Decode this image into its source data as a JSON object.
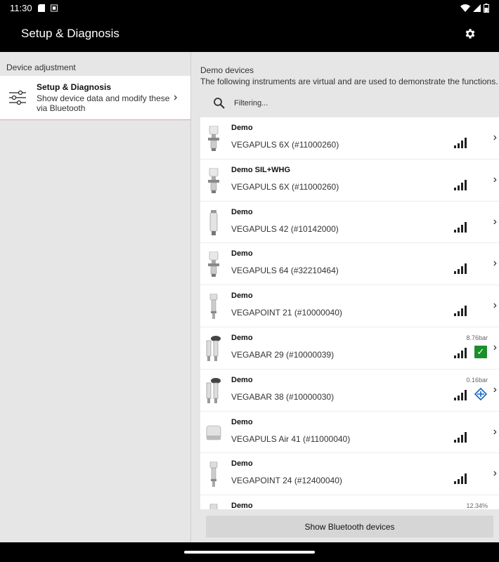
{
  "status_bar": {
    "time": "11:30"
  },
  "app_bar": {
    "title": "Setup & Diagnosis"
  },
  "left": {
    "section_label": "Device adjustment",
    "item": {
      "title": "Setup & Diagnosis",
      "description": "Show device data and modify these via Bluetooth"
    }
  },
  "right": {
    "header": "Demo devices",
    "subheader": "The following instruments are virtual and are used to demonstrate the functions.",
    "filter_placeholder": "Filtering...",
    "devices": [
      {
        "name": "Demo",
        "model": "VEGAPULS 6X (#11000260)",
        "value": "",
        "status": "",
        "image": "radar-sensor"
      },
      {
        "name": "Demo SIL+WHG",
        "model": "VEGAPULS 6X (#11000260)",
        "value": "",
        "status": "",
        "image": "radar-sensor"
      },
      {
        "name": "Demo",
        "model": "VEGAPULS 42 (#10142000)",
        "value": "",
        "status": "",
        "image": "rod-sensor"
      },
      {
        "name": "Demo",
        "model": "VEGAPULS 64 (#32210464)",
        "value": "",
        "status": "",
        "image": "radar-sensor"
      },
      {
        "name": "Demo",
        "model": "VEGAPOINT 21 (#10000040)",
        "value": "",
        "status": "",
        "image": "point-sensor"
      },
      {
        "name": "Demo",
        "model": "VEGABAR 29 (#10000039)",
        "value": "8.76bar",
        "status": "ok",
        "image": "pressure-sensor"
      },
      {
        "name": "Demo",
        "model": "VEGABAR 38 (#10000030)",
        "value": "0.16bar",
        "status": "function-check",
        "image": "pressure-sensor"
      },
      {
        "name": "Demo",
        "model": "VEGAPULS Air 41 (#11000040)",
        "value": "",
        "status": "",
        "image": "air-sensor"
      },
      {
        "name": "Demo",
        "model": "VEGAPOINT 24 (#12400040)",
        "value": "",
        "status": "",
        "image": "point-sensor"
      },
      {
        "name": "Demo",
        "model": "",
        "value": "12.34%",
        "status": "",
        "image": "point-sensor"
      }
    ],
    "bt_button": "Show Bluetooth devices"
  },
  "colors": {
    "app_bar": "#000000",
    "ok": "#1a8f2a",
    "function_check": "#1565c0"
  }
}
